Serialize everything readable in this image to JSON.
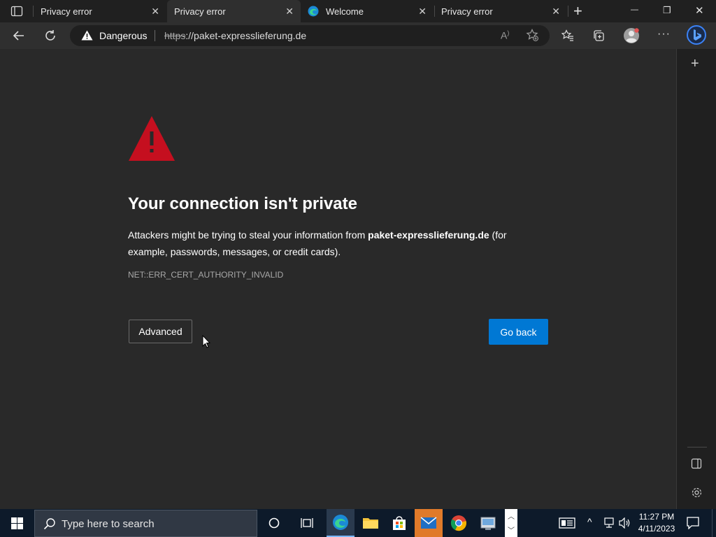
{
  "tabs": [
    {
      "title": "Privacy error",
      "close": "✕"
    },
    {
      "title": "Privacy error",
      "close": "✕"
    },
    {
      "title": "Welcome",
      "close": "✕"
    },
    {
      "title": "Privacy error",
      "close": "✕"
    }
  ],
  "new_tab": "+",
  "window_controls": {
    "minimize": "—",
    "restore": "❐",
    "close": "✕"
  },
  "address": {
    "security_label": "Dangerous",
    "scheme": "https",
    "rest": "://paket-expresslieferung.de"
  },
  "error_page": {
    "heading": "Your connection isn't private",
    "desc_prefix": "Attackers might be trying to steal your information from ",
    "desc_domain": "paket-expresslieferung.de",
    "desc_suffix": " (for example, passwords, messages, or credit cards).",
    "error_code": "NET::ERR_CERT_AUTHORITY_INVALID",
    "advanced_button": "Advanced",
    "go_back_button": "Go back",
    "primary_color": "#0078d4",
    "warning_color": "#c50f1f"
  },
  "sidebar": {
    "add": "+"
  },
  "taskbar": {
    "search_placeholder": "Type here to search",
    "clock_time": "11:27 PM",
    "clock_date": "4/11/2023"
  }
}
